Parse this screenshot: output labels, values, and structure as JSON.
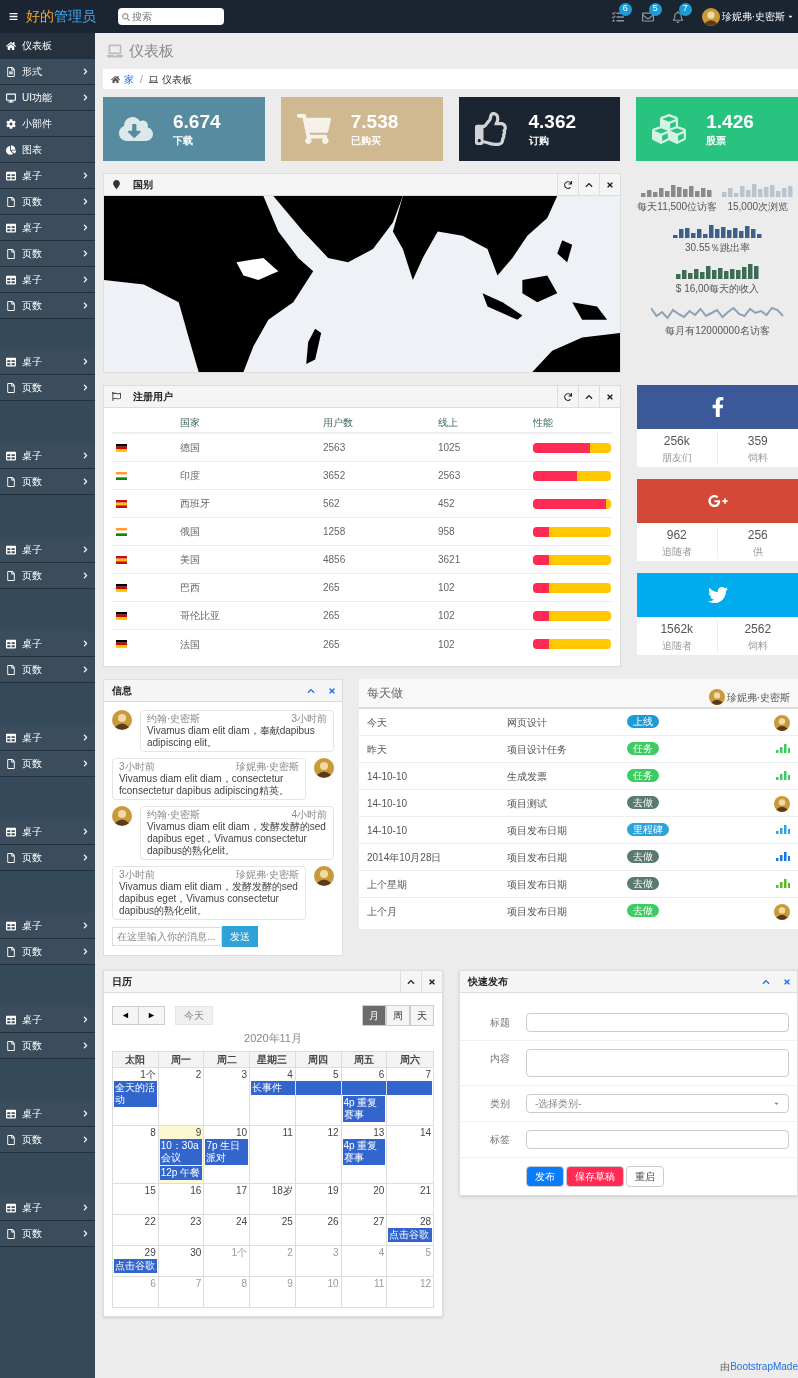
{
  "header": {
    "logo_a": "好的",
    "logo_b": "管理员",
    "search": {
      "placeholder": "搜索"
    },
    "badges": [
      {
        "count": "6"
      },
      {
        "count": "5"
      },
      {
        "count": "7"
      }
    ],
    "user": "珍妮弗·史密斯"
  },
  "sidebar": {
    "sections": [
      {
        "items": [
          {
            "label": "仪表板",
            "selected": true,
            "submenu": false
          },
          {
            "label": "形式",
            "selected": false,
            "submenu": true
          },
          {
            "label": "UI功能",
            "selected": false,
            "submenu": true
          },
          {
            "label": "小部件",
            "selected": false,
            "submenu": false
          },
          {
            "label": "图表",
            "selected": false,
            "submenu": false
          },
          {
            "label": "桌子",
            "selected": false,
            "submenu": true
          },
          {
            "label": "页数",
            "selected": false,
            "submenu": true
          },
          {
            "label": "桌子",
            "selected": false,
            "submenu": true
          },
          {
            "label": "页数",
            "selected": false,
            "submenu": true
          },
          {
            "label": "桌子",
            "selected": false,
            "submenu": true
          },
          {
            "label": "页数",
            "selected": false,
            "submenu": true
          }
        ]
      },
      {
        "items": [
          {
            "label": "桌子",
            "selected": false,
            "submenu": true
          },
          {
            "label": "页数",
            "selected": false,
            "submenu": true
          }
        ]
      },
      {
        "items": [
          {
            "label": "桌子",
            "selected": false,
            "submenu": true
          },
          {
            "label": "页数",
            "selected": false,
            "submenu": true
          }
        ]
      },
      {
        "items": [
          {
            "label": "桌子",
            "selected": false,
            "submenu": true
          },
          {
            "label": "页数",
            "selected": false,
            "submenu": true
          }
        ]
      },
      {
        "items": [
          {
            "label": "桌子",
            "selected": false,
            "submenu": true
          },
          {
            "label": "页数",
            "selected": false,
            "submenu": true
          }
        ]
      },
      {
        "items": [
          {
            "label": "桌子",
            "selected": false,
            "submenu": true
          },
          {
            "label": "页数",
            "selected": false,
            "submenu": true
          }
        ]
      },
      {
        "items": [
          {
            "label": "桌子",
            "selected": false,
            "submenu": true
          },
          {
            "label": "页数",
            "selected": false,
            "submenu": true
          }
        ]
      },
      {
        "items": [
          {
            "label": "桌子",
            "selected": false,
            "submenu": true
          },
          {
            "label": "页数",
            "selected": false,
            "submenu": true
          }
        ]
      },
      {
        "items": [
          {
            "label": "桌子",
            "selected": false,
            "submenu": true
          },
          {
            "label": "页数",
            "selected": false,
            "submenu": true
          }
        ]
      },
      {
        "items": [
          {
            "label": "桌子",
            "selected": false,
            "submenu": true
          },
          {
            "label": "页数",
            "selected": false,
            "submenu": true
          }
        ]
      },
      {
        "items": [
          {
            "label": "桌子",
            "selected": false,
            "submenu": true
          },
          {
            "label": "页数",
            "selected": false,
            "submenu": true
          }
        ]
      }
    ]
  },
  "page_title": "仪表板",
  "breadcrumb": {
    "items": [
      "家",
      "仪表板"
    ],
    "separator": "/"
  },
  "stats": [
    {
      "value": "6.674",
      "label": "下载",
      "color": "#578ba0"
    },
    {
      "value": "7.538",
      "label": "已购买",
      "color": "#d0b890"
    },
    {
      "value": "4.362",
      "label": "订购",
      "color": "#1b2532"
    },
    {
      "value": "1.426",
      "label": "股票",
      "color": "#27c37f"
    }
  ],
  "map_panel": {
    "title": "国别"
  },
  "sparklines": [
    {
      "caption": "每天11,500位访客",
      "kind": "bars",
      "color": "#8a8a8a"
    },
    {
      "caption": "15,000次浏览",
      "kind": "bars",
      "color": "#b9c4cf"
    },
    {
      "caption": "30.55％跳出率",
      "kind": "bars",
      "color": "#3d5f8c"
    },
    {
      "caption": "$ 16,00每天的收入",
      "kind": "bars",
      "color": "#3d6b54"
    },
    {
      "caption": "每月有12000000名访客",
      "kind": "line",
      "color": "#8aa3b8"
    }
  ],
  "users_panel": {
    "title": "注册用户",
    "columns": [
      "国家",
      "用户数",
      "线上",
      "性能"
    ],
    "rows": [
      {
        "kind": "de",
        "country": "德国",
        "users": "2563",
        "online": "1025",
        "level": 0.73
      },
      {
        "kind": "in",
        "country": "印度",
        "users": "3652",
        "online": "2563",
        "level": 0.57
      },
      {
        "kind": "es",
        "country": "西班牙",
        "users": "562",
        "online": "452",
        "level": 0.93
      },
      {
        "kind": "in",
        "country": "俄国",
        "users": "1258",
        "online": "958",
        "level": 0.2
      },
      {
        "kind": "es",
        "country": "美国",
        "users": "4856",
        "online": "3621",
        "level": 0.2
      },
      {
        "kind": "de",
        "country": "巴西",
        "users": "265",
        "online": "102",
        "level": 0.2
      },
      {
        "kind": "de",
        "country": "哥伦比亚",
        "users": "265",
        "online": "102",
        "level": 0.2
      },
      {
        "kind": "de",
        "country": "法国",
        "users": "265",
        "online": "102",
        "level": 0.2
      }
    ]
  },
  "social": [
    {
      "kind": "facebook",
      "color": "#3b5998",
      "stats": [
        {
          "value": "256k",
          "label": "朋友们"
        },
        {
          "value": "359",
          "label": "饲料"
        }
      ]
    },
    {
      "kind": "googleplus",
      "color": "#d34836",
      "stats": [
        {
          "value": "962",
          "label": "追随者"
        },
        {
          "value": "256",
          "label": "供"
        }
      ]
    },
    {
      "kind": "twitter",
      "color": "#00acee",
      "stats": [
        {
          "value": "1562k",
          "label": "追随者"
        },
        {
          "value": "2562",
          "label": "饲料"
        }
      ]
    }
  ],
  "messages": {
    "title": "信息",
    "items": [
      {
        "kind": "received",
        "author": "约翰·史密斯",
        "time": "3小时前",
        "text": "Vivamus diam elit diam，奉献dapibus adipiscing elit。"
      },
      {
        "kind": "sent",
        "author": "珍妮弗·史密斯",
        "time": "3小时前",
        "text": "Vivamus diam elit diam，consectetur fconsectetur dapibus adipiscing精英。"
      },
      {
        "kind": "received",
        "author": "约翰·史密斯",
        "time": "4小时前",
        "text": "Vivamus diam elit diam，发酵发酵的sed dapibus eget，Vivamus consectetur dapibus的熟化elit。"
      },
      {
        "kind": "sent",
        "author": "珍妮弗·史密斯",
        "time": "3小时前",
        "text": "Vivamus diam elit diam，发酵发酵的sed dapibus eget，Vivamus consectetur dapibus的熟化elit。"
      }
    ],
    "input": {
      "placeholder": "在这里输入你的消息..."
    },
    "send": "发送"
  },
  "todo": {
    "title": "每天做",
    "user": "珍妮弗·史密斯",
    "rows": [
      {
        "when": "今天",
        "task": "网页设计",
        "badge": {
          "label": "上线",
          "color": "#1d9bd6"
        },
        "end": {
          "kind": "avatar"
        }
      },
      {
        "when": "昨天",
        "task": "项目设计任务",
        "badge": {
          "label": "任务",
          "color": "#3ccc62"
        },
        "end": {
          "kind": "bars",
          "color": "#3ccc62"
        }
      },
      {
        "when": "14-10-10",
        "task": "生成发票",
        "badge": {
          "label": "任务",
          "color": "#3ccc62"
        },
        "end": {
          "kind": "bars",
          "color": "#3ccc62"
        }
      },
      {
        "when": "14-10-10",
        "task": "项目测试",
        "badge": {
          "label": "去做",
          "color": "#5a7a6e"
        },
        "end": {
          "kind": "avatar"
        }
      },
      {
        "when": "14-10-10",
        "task": "项目发布日期",
        "badge": {
          "label": "里程碑",
          "color": "#2fa3d9"
        },
        "end": {
          "kind": "bars",
          "color": "#2fa3d9"
        }
      },
      {
        "when": "2014年10月28日",
        "task": "项目发布日期",
        "badge": {
          "label": "去做",
          "color": "#5a7a6e"
        },
        "end": {
          "kind": "bars",
          "color": "#1a73e8"
        }
      },
      {
        "when": "上个星期",
        "task": "项目发布日期",
        "badge": {
          "label": "去做",
          "color": "#5a7a6e"
        },
        "end": {
          "kind": "bars",
          "color": "#5cb82a"
        }
      },
      {
        "when": "上个月",
        "task": "项目发布日期",
        "badge": {
          "label": "去做",
          "color": "#3ccc62"
        },
        "end": {
          "kind": "avatar"
        }
      }
    ]
  },
  "calendar": {
    "title": "日历",
    "prev": "◄",
    "next": "►",
    "today": {
      "label": "今天",
      "disabled": true
    },
    "views": [
      {
        "label": "月",
        "selected": true
      },
      {
        "label": "周",
        "selected": false
      },
      {
        "label": "天",
        "selected": false
      }
    ],
    "month": "2020年11月",
    "weekdays": [
      "太阳",
      "周一",
      "周二",
      "星期三",
      "周四",
      "周五",
      "周六"
    ],
    "weeks": [
      {
        "days": [
          {
            "label": "1个",
            "other": false,
            "today": false,
            "events": [
              {
                "text": "全天的活动"
              }
            ]
          },
          {
            "label": "2",
            "other": false,
            "today": false
          },
          {
            "label": "3",
            "other": false,
            "today": false
          },
          {
            "label": "4",
            "other": false,
            "today": false,
            "events": [
              {
                "text": "长事件"
              }
            ]
          },
          {
            "label": "5",
            "other": false,
            "today": false,
            "events": [
              {
                "kind": "continued"
              }
            ]
          },
          {
            "label": "6",
            "other": false,
            "today": false,
            "events": [
              {
                "kind": "continued"
              },
              {
                "text": "4p 重复赛事"
              }
            ]
          },
          {
            "label": "7",
            "other": false,
            "today": false,
            "events": [
              {
                "kind": "continued"
              }
            ]
          }
        ]
      },
      {
        "days": [
          {
            "label": "8",
            "other": false,
            "today": false
          },
          {
            "label": "9",
            "other": false,
            "today": true,
            "events": [
              {
                "text": "10：30a 会议"
              },
              {
                "text": "12p 午餐"
              }
            ]
          },
          {
            "label": "10",
            "other": false,
            "today": false,
            "events": [
              {
                "text": "7p 生日派对"
              }
            ]
          },
          {
            "label": "11",
            "other": false,
            "today": false
          },
          {
            "label": "12",
            "other": false,
            "today": false
          },
          {
            "label": "13",
            "other": false,
            "today": false,
            "events": [
              {
                "text": "4p 重复赛事"
              }
            ]
          },
          {
            "label": "14",
            "other": false,
            "today": false
          }
        ]
      },
      {
        "days": [
          {
            "label": "15",
            "other": false,
            "today": false
          },
          {
            "label": "16",
            "other": false,
            "today": false
          },
          {
            "label": "17",
            "other": false,
            "today": false
          },
          {
            "label": "18岁",
            "other": false,
            "today": false
          },
          {
            "label": "19",
            "other": false,
            "today": false
          },
          {
            "label": "20",
            "other": false,
            "today": false
          },
          {
            "label": "21",
            "other": false,
            "today": false
          }
        ]
      },
      {
        "days": [
          {
            "label": "22",
            "other": false,
            "today": false
          },
          {
            "label": "23",
            "other": false,
            "today": false
          },
          {
            "label": "24",
            "other": false,
            "today": false
          },
          {
            "label": "25",
            "other": false,
            "today": false
          },
          {
            "label": "26",
            "other": false,
            "today": false
          },
          {
            "label": "27",
            "other": false,
            "today": false
          },
          {
            "label": "28",
            "other": false,
            "today": false,
            "events": [
              {
                "text": "点击谷歌"
              }
            ]
          }
        ]
      },
      {
        "days": [
          {
            "label": "29",
            "other": false,
            "today": false,
            "events": [
              {
                "text": "点击谷歌"
              }
            ]
          },
          {
            "label": "30",
            "other": false,
            "today": false
          },
          {
            "label": "1个",
            "other": true,
            "today": false
          },
          {
            "label": "2",
            "other": true,
            "today": false
          },
          {
            "label": "3",
            "other": true,
            "today": false
          },
          {
            "label": "4",
            "other": true,
            "today": false
          },
          {
            "label": "5",
            "other": true,
            "today": false
          }
        ]
      },
      {
        "days": [
          {
            "label": "6",
            "other": true,
            "today": false
          },
          {
            "label": "7",
            "other": true,
            "today": false
          },
          {
            "label": "8",
            "other": true,
            "today": false
          },
          {
            "label": "9",
            "other": true,
            "today": false
          },
          {
            "label": "10",
            "other": true,
            "today": false
          },
          {
            "label": "11",
            "other": true,
            "today": false
          },
          {
            "label": "12",
            "other": true,
            "today": false
          }
        ]
      }
    ]
  },
  "quick_post": {
    "title": "快速发布",
    "fields": [
      {
        "label": "标题",
        "kind": "input"
      },
      {
        "label": "内容",
        "kind": "textarea"
      },
      {
        "label": "类别",
        "kind": "select",
        "placeholder": "-选择类别-"
      },
      {
        "label": "标签",
        "kind": "input"
      }
    ],
    "buttons": [
      {
        "label": "发布",
        "color": "#0a7cf8"
      },
      {
        "label": "保存草稿",
        "color": "#ff2b55"
      },
      {
        "label": "重启",
        "color": "#ffffff"
      }
    ]
  },
  "footer": {
    "prefix": "由",
    "link": "BootstrapMade"
  }
}
